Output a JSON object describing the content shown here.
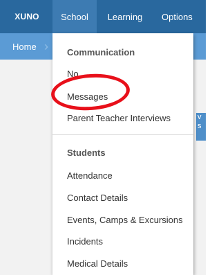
{
  "navbar": {
    "logo": "XUNO",
    "tabs": [
      {
        "label": "School"
      },
      {
        "label": "Learning"
      },
      {
        "label": "Options"
      }
    ]
  },
  "subbar": {
    "home_label": "Home",
    "chevron": "›"
  },
  "side_tab": {
    "text": "v s"
  },
  "dropdown": {
    "sections": [
      {
        "header": "Communication",
        "items": [
          "No",
          "Messages",
          "Parent Teacher Interviews"
        ]
      },
      {
        "header": "Students",
        "items": [
          "Attendance",
          "Contact Details",
          "Events, Camps & Excursions",
          "Incidents",
          "Medical Details"
        ]
      }
    ]
  },
  "colors": {
    "navbar": "#29689e",
    "active_tab": "#3d7bb2",
    "subbar": "#5b9bd5",
    "annotation": "#e8101a"
  }
}
